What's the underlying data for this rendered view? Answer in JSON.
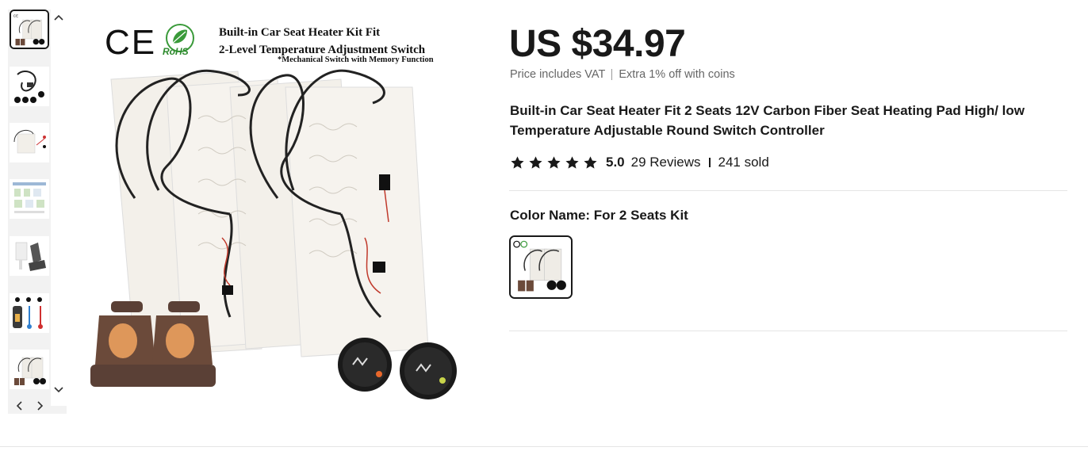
{
  "product": {
    "price": "US $34.97",
    "price_vat_note": "Price includes VAT",
    "coins_note": "Extra 1% off with coins",
    "title": "Built-in Car Seat Heater Fit 2 Seats 12V Carbon Fiber Seat Heating Pad High/ low Temperature Adjustable Round Switch Controller",
    "rating": {
      "stars": 5,
      "score": "5.0",
      "reviews": "29 Reviews",
      "sold": "241 sold"
    },
    "color": {
      "label": "Color Name: For 2 Seats Kit"
    }
  },
  "main_image": {
    "cert_ce": "CE",
    "cert_rohs": "RoHS",
    "headline_1": "Built-in Car Seat Heater Kit Fit",
    "headline_2": "2-Level Temperature Adjustment Switch",
    "headline_3": "*Mechanical Switch with Memory Function"
  },
  "thumbnails": [
    {
      "name": "thumb-kit-overview",
      "active": true
    },
    {
      "name": "thumb-wiring",
      "active": false
    },
    {
      "name": "thumb-pads",
      "active": false
    },
    {
      "name": "thumb-instructions",
      "active": false
    },
    {
      "name": "thumb-seat-install",
      "active": false
    },
    {
      "name": "thumb-components",
      "active": false
    },
    {
      "name": "thumb-kit-overview-2",
      "active": false
    }
  ],
  "icons": {
    "scroll_up": "chevron-up-icon",
    "scroll_down": "chevron-down-icon",
    "prev": "chevron-left-icon",
    "next": "chevron-right-icon",
    "star": "star-icon"
  },
  "colors": {
    "text": "#191919",
    "muted": "#666666",
    "divider": "#e5e5e5",
    "rail_bg": "#f2f2f2"
  }
}
